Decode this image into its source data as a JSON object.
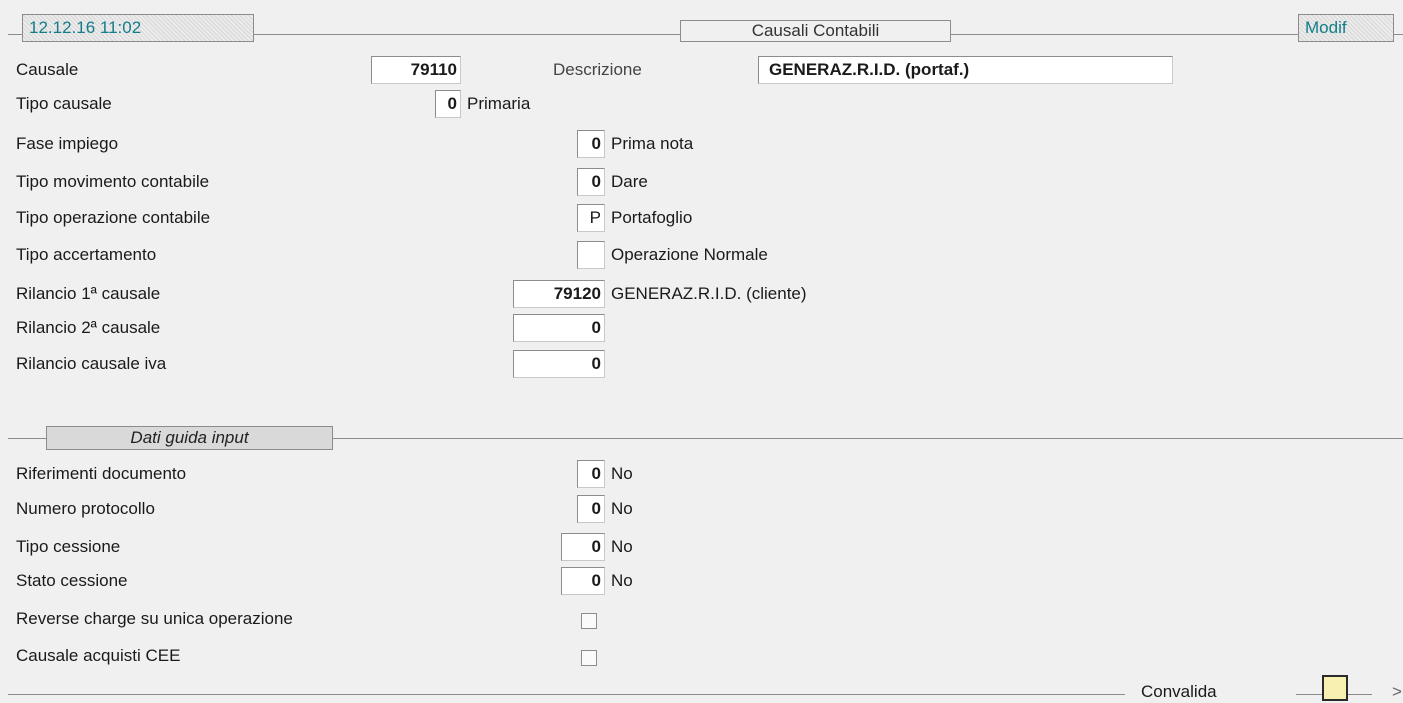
{
  "header": {
    "datetime": "12.12.16 11:02",
    "title": "Causali Contabili",
    "mode": "Modif"
  },
  "main": {
    "causale": {
      "label": "Causale",
      "value": "79110"
    },
    "descrizione": {
      "label": "Descrizione",
      "value": "GENERAZ.R.I.D.  (portaf.)"
    },
    "tipo_causale": {
      "label": "Tipo causale",
      "value": "0",
      "desc": "Primaria"
    },
    "fase_impiego": {
      "label": "Fase impiego",
      "value": "0",
      "desc": "Prima nota"
    },
    "tipo_movimento": {
      "label": "Tipo movimento contabile",
      "value": "0",
      "desc": "Dare"
    },
    "tipo_operazione": {
      "label": "Tipo operazione contabile",
      "value": "P",
      "desc": "Portafoglio"
    },
    "tipo_accertamento": {
      "label": "Tipo accertamento",
      "value": "",
      "desc": "Operazione Normale"
    },
    "rilancio_1": {
      "label": "Rilancio 1ª causale",
      "value": "79120",
      "desc": "GENERAZ.R.I.D.  (cliente)"
    },
    "rilancio_2": {
      "label": "Rilancio 2ª causale",
      "value": "0"
    },
    "rilancio_iva": {
      "label": "Rilancio causale iva",
      "value": "0"
    }
  },
  "section": {
    "title": "Dati guida input",
    "riferimenti": {
      "label": "Riferimenti documento",
      "value": "0",
      "desc": "No"
    },
    "protocollo": {
      "label": "Numero protocollo",
      "value": "0",
      "desc": "No"
    },
    "tipo_cessione": {
      "label": "Tipo cessione",
      "value": "0",
      "desc": "No"
    },
    "stato_cessione": {
      "label": "Stato cessione",
      "value": "0",
      "desc": "No"
    },
    "reverse_charge": {
      "label": "Reverse charge su unica operazione",
      "checked": false
    },
    "acquisti_cee": {
      "label": "Causale acquisti CEE",
      "checked": false
    }
  },
  "footer": {
    "convalida_label": "Convalida",
    "more_glyph": ">"
  },
  "colors": {
    "accent": "#137d8a",
    "background": "#f0f0f0",
    "button_fill": "#f7f0b0"
  }
}
